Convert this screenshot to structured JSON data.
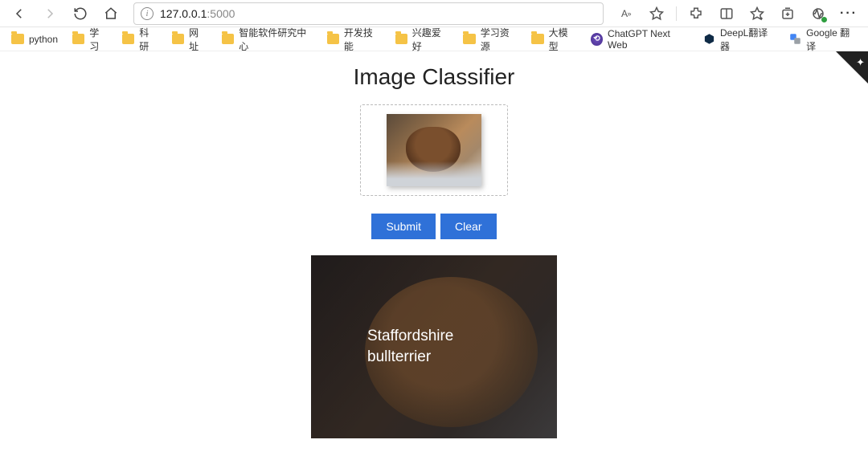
{
  "browser": {
    "url_host": "127.0.0.1",
    "url_port": ":5000",
    "text_size_label": "A",
    "text_size_super": "»"
  },
  "bookmarks": [
    {
      "type": "folder",
      "label": "python"
    },
    {
      "type": "folder",
      "label": "学习"
    },
    {
      "type": "folder",
      "label": "科研"
    },
    {
      "type": "folder",
      "label": "网址"
    },
    {
      "type": "folder",
      "label": "智能软件研究中心"
    },
    {
      "type": "folder",
      "label": "开发技能"
    },
    {
      "type": "folder",
      "label": "兴趣爱好"
    },
    {
      "type": "folder",
      "label": "学习资源"
    },
    {
      "type": "folder",
      "label": "大模型"
    },
    {
      "type": "chatgpt",
      "label": "ChatGPT Next Web"
    },
    {
      "type": "deepl",
      "label": "DeepL翻译器"
    },
    {
      "type": "google",
      "label": "Google 翻译"
    }
  ],
  "app": {
    "title": "Image Classifier",
    "submit_label": "Submit",
    "clear_label": "Clear",
    "result_line1": "Staffordshire",
    "result_line2": "bullterrier"
  }
}
